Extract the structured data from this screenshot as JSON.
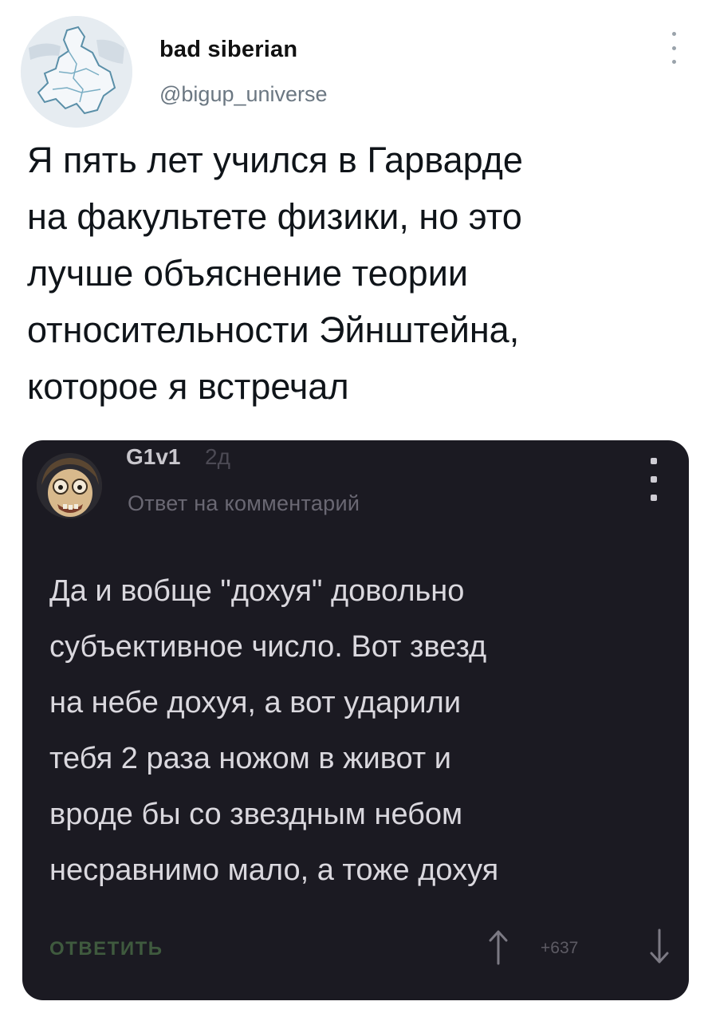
{
  "tweet": {
    "author_name": "bad siberian",
    "author_handle": "@bigup_universe",
    "text_lines": [
      "Я пять лет учился в Гарварде",
      "на факультете физики, но это",
      "лучше объяснение теории",
      "относительности Эйнштейна,",
      "которое я встречал"
    ]
  },
  "comment": {
    "username": "G1v1",
    "time": "2д",
    "reply_to": "Ответ на комментарий",
    "text_lines": [
      "Да и вобще \"дохуя\" довольно",
      "субъективное число. Вот звезд",
      "на небе дохуя, а вот ударили",
      "тебя 2 раза ножом в живот и",
      "вроде бы со звездным небом",
      "несравнимо мало, а тоже дохуя"
    ],
    "reply_button": "ОТВЕТИТЬ",
    "score": "+637"
  },
  "colors": {
    "card_background": "#1b1a22",
    "tweet_text": "#0f1419",
    "handle_gray": "#6b7782",
    "reply_green": "#3f5a3e"
  },
  "icons": {
    "tweet_menu": "more-vertical-icon",
    "comment_menu": "more-vertical-icon",
    "upvote": "arrow-up-icon",
    "downvote": "arrow-down-icon"
  }
}
